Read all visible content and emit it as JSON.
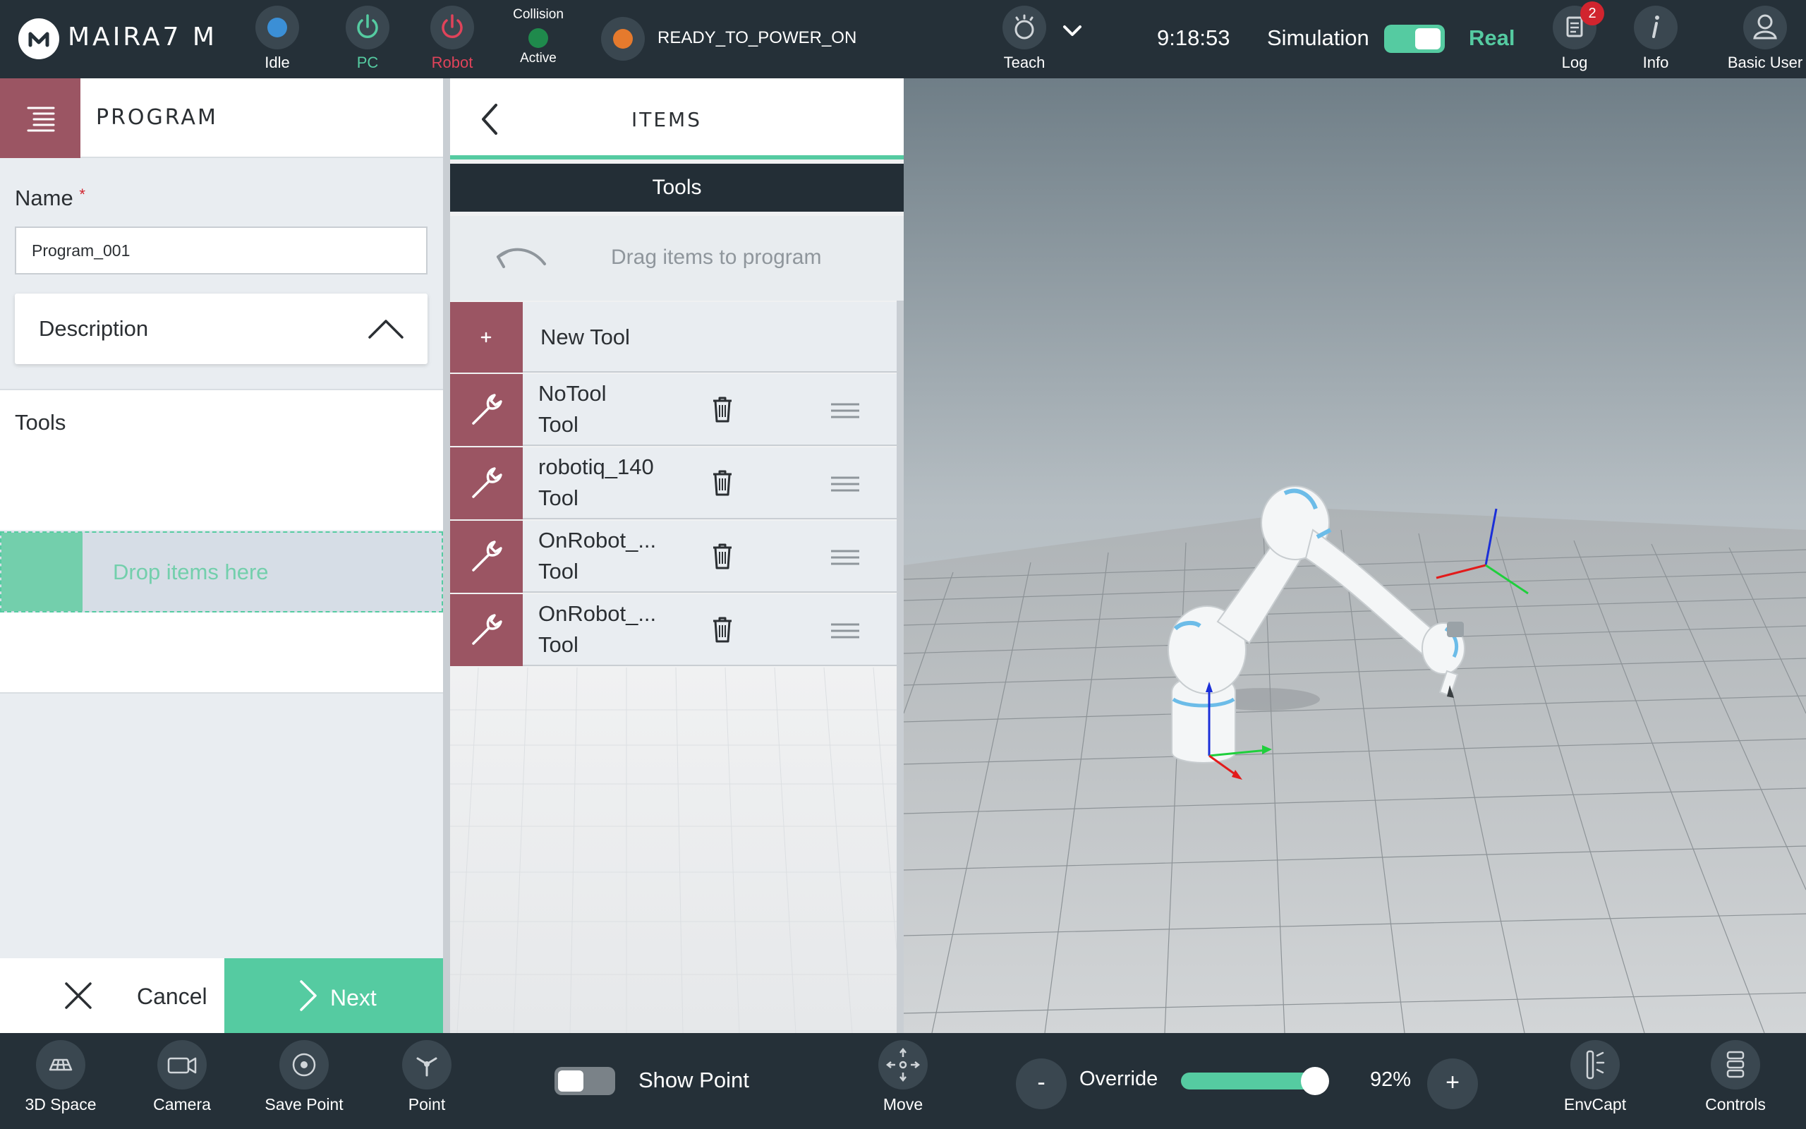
{
  "topbar": {
    "logo_text": "MAIRA7 M",
    "idle_label": "Idle",
    "pc_label": "PC",
    "robot_label": "Robot",
    "collision_title": "Collision",
    "collision_status": "Active",
    "state": "READY_TO_POWER_ON",
    "teach_label": "Teach",
    "time": "9:18:53",
    "simulation_label": "Simulation",
    "real_label": "Real",
    "log_label": "Log",
    "log_badge": "2",
    "info_label": "Info",
    "user_label": "Basic User",
    "colors": {
      "idle_dot": "#3b8fd6",
      "pc": "#55cba1",
      "robot": "#e0435a",
      "collision_dot": "#1f8a4c",
      "state_dot": "#e57a2d",
      "accent": "#55cba1"
    }
  },
  "program": {
    "title": "PROGRAM",
    "name_label": "Name",
    "required_mark": "*",
    "name_value": "Program_001",
    "description_label": "Description",
    "tools_label": "Tools",
    "drop_hint": "Drop items here",
    "cancel_label": "Cancel",
    "next_label": "Next"
  },
  "items": {
    "title": "ITEMS",
    "category": "Tools",
    "drag_hint": "Drag items to program",
    "new_item_label": "New Tool",
    "list": [
      {
        "name": "NoTool",
        "type": "Tool"
      },
      {
        "name": "robotiq_140",
        "type": "Tool"
      },
      {
        "name": "OnRobot_...",
        "type": "Tool"
      },
      {
        "name": "OnRobot_...",
        "type": "Tool"
      }
    ]
  },
  "bottombar": {
    "space_label": "3D Space",
    "camera_label": "Camera",
    "save_point_label": "Save Point",
    "point_label": "Point",
    "show_point_label": "Show Point",
    "move_label": "Move",
    "override_minus": "-",
    "override_label": "Override",
    "override_value": "92%",
    "override_fraction": 0.92,
    "override_plus": "+",
    "envcapt_label": "EnvCapt",
    "controls_label": "Controls"
  }
}
